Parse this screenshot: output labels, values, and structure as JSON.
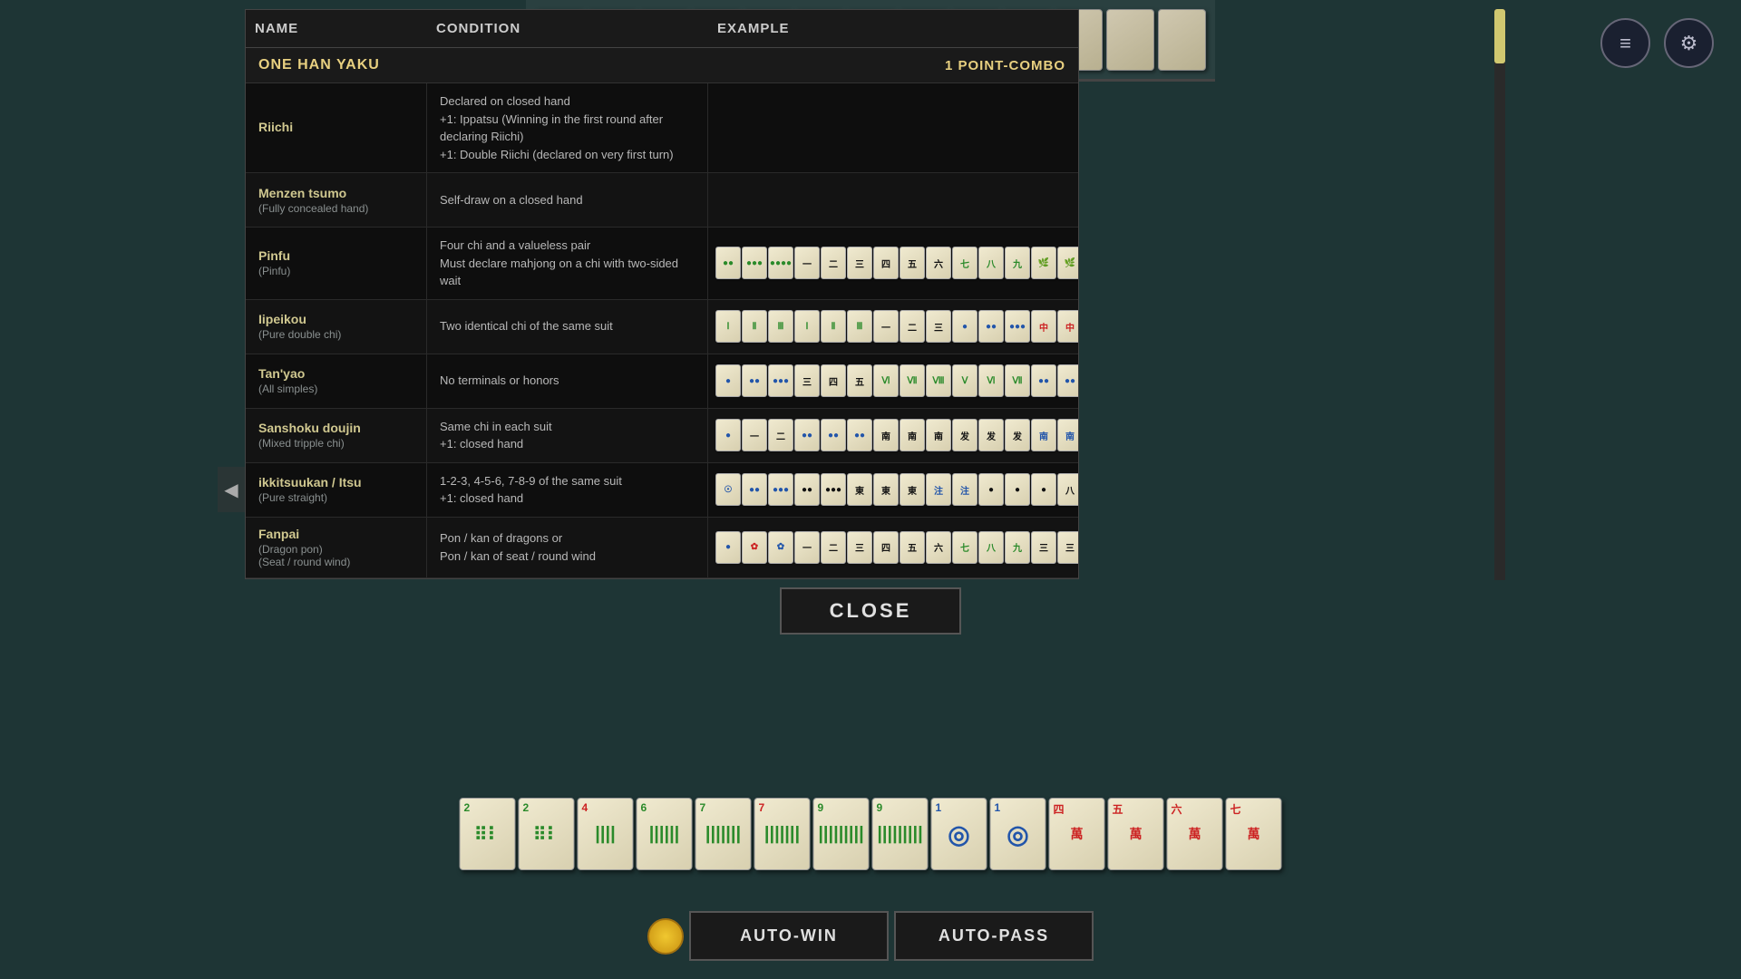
{
  "topRack": {
    "tileCount": 13
  },
  "topRightIcons": {
    "logIcon": "≡",
    "gearIcon": "⚙"
  },
  "table": {
    "headers": {
      "name": "NAME",
      "condition": "CONDITION",
      "example": "EXAMPLE"
    },
    "section": {
      "title": "ONE HAN YAKU",
      "points": "1 POINT-COMBO"
    },
    "rows": [
      {
        "name": "Riichi",
        "subname": "",
        "condition": "Declared on closed hand\n+1: Ippatsu (Winning in the first round after declaring Riichi)\n+1: Double Riichi (declared on very first turn)",
        "hasExample": false
      },
      {
        "name": "Menzen tsumo",
        "subname": "(Fully concealed hand)",
        "condition": "Self-draw on a closed hand",
        "hasExample": false
      },
      {
        "name": "Pinfu",
        "subname": "(Pinfu)",
        "condition": "Four chi and a valueless pair\nMust declare mahjong on a chi with two-sided wait",
        "hasExample": true
      },
      {
        "name": "Iipeikou",
        "subname": "(Pure double chi)",
        "condition": "Two identical chi of the same suit",
        "hasExample": true
      },
      {
        "name": "Tan'yao",
        "subname": "(All simples)",
        "condition": "No terminals or honors",
        "hasExample": true
      },
      {
        "name": "Sanshoku doujin",
        "subname": "(Mixed tripple chi)",
        "condition": "Same chi in each suit\n+1: closed hand",
        "hasExample": true
      },
      {
        "name": "ikkitsuukan / Itsu",
        "subname": "(Pure straight)",
        "condition": "1-2-3, 4-5-6, 7-8-9 of the same suit\n+1: closed hand",
        "hasExample": true
      },
      {
        "name": "Fanpai",
        "subname": "(Dragon pon)\n(Seat / round wind)",
        "condition": "Pon / kan of dragons or\nPon / kan of seat / round wind",
        "hasExample": true
      }
    ]
  },
  "closeButton": {
    "label": "CLOSE"
  },
  "bottomBar": {
    "autoWin": "AUTO-WIN",
    "autoPass": "AUTO-PASS"
  },
  "handTiles": [
    {
      "num": "2",
      "suit": "bamboo",
      "color": "green",
      "icon": "🀐"
    },
    {
      "num": "2",
      "suit": "bamboo",
      "color": "green",
      "icon": "🀐"
    },
    {
      "num": "4",
      "suit": "bamboo",
      "color": "red",
      "icon": "🀓"
    },
    {
      "num": "6",
      "suit": "bamboo",
      "color": "green",
      "icon": "🀕"
    },
    {
      "num": "7",
      "suit": "bamboo",
      "color": "green",
      "icon": "🀖"
    },
    {
      "num": "7",
      "suit": "bamboo",
      "color": "red",
      "icon": "🀖"
    },
    {
      "num": "9",
      "suit": "bamboo",
      "color": "green",
      "icon": "🀘"
    },
    {
      "num": "9",
      "suit": "bamboo",
      "color": "green",
      "icon": "🀘"
    },
    {
      "num": "1",
      "suit": "circle",
      "color": "blue-dark",
      "icon": "🀙"
    },
    {
      "num": "1",
      "suit": "circle",
      "color": "blue-dark",
      "icon": "🀙"
    },
    {
      "num": "4",
      "suit": "man",
      "color": "red",
      "icon": "🀇"
    },
    {
      "num": "5",
      "suit": "man",
      "color": "red",
      "icon": "🀋"
    },
    {
      "num": "6",
      "suit": "man",
      "color": "red",
      "icon": "🀌"
    },
    {
      "num": "7",
      "suit": "man",
      "color": "red",
      "icon": "🀍"
    }
  ]
}
